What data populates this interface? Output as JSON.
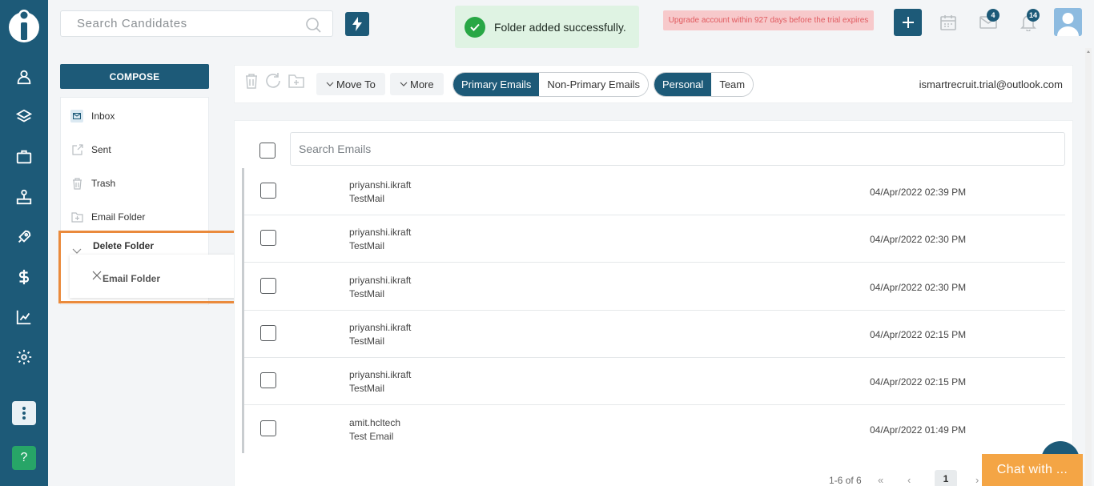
{
  "header": {
    "search_placeholder": "Search Candidates",
    "toast_message": "Folder added successfully.",
    "trial_notice": "Upgrade account within 927 days before the trial expires",
    "mail_badge": "4",
    "notification_badge": "14"
  },
  "sidebar": {
    "compose_label": "COMPOSE",
    "folders": [
      {
        "label": "Inbox",
        "icon": "inbox-icon"
      },
      {
        "label": "Sent",
        "icon": "sent-icon"
      },
      {
        "label": "Trash",
        "icon": "trash-icon"
      },
      {
        "label": "Email Folder",
        "icon": "add-folder-icon"
      }
    ],
    "delete_folder": {
      "label": "Delete Folder",
      "item": "Email Folder"
    }
  },
  "toolbar": {
    "move_to": "Move To",
    "more": "More",
    "mail_types": [
      "Primary Emails",
      "Non-Primary Emails"
    ],
    "scopes": [
      "Personal",
      "Team"
    ],
    "account": "ismartrecruit.trial@outlook.com"
  },
  "list": {
    "search_placeholder": "Search Emails",
    "emails": [
      {
        "from": "priyanshi.ikraft",
        "subject": "TestMail",
        "date": "04/Apr/2022 02:39 PM"
      },
      {
        "from": "priyanshi.ikraft",
        "subject": "TestMail",
        "date": "04/Apr/2022 02:30 PM"
      },
      {
        "from": "priyanshi.ikraft",
        "subject": "TestMail",
        "date": "04/Apr/2022 02:30 PM"
      },
      {
        "from": "priyanshi.ikraft",
        "subject": "TestMail",
        "date": "04/Apr/2022 02:15 PM"
      },
      {
        "from": "priyanshi.ikraft",
        "subject": "TestMail",
        "date": "04/Apr/2022 02:15 PM"
      },
      {
        "from": "amit.hcltech",
        "subject": "Test Email",
        "date": "04/Apr/2022 01:49 PM"
      }
    ]
  },
  "pagination": {
    "summary": "1-6 of 6",
    "current_page": "1",
    "first": "«",
    "prev": "‹",
    "next": "›"
  },
  "chat": {
    "label": "Chat with ..."
  },
  "colors": {
    "brand": "#1d5a78",
    "success": "#28a745",
    "warning_bg": "#f7c9cb",
    "highlight": "#ea8a3c",
    "chat": "#f4a545"
  }
}
